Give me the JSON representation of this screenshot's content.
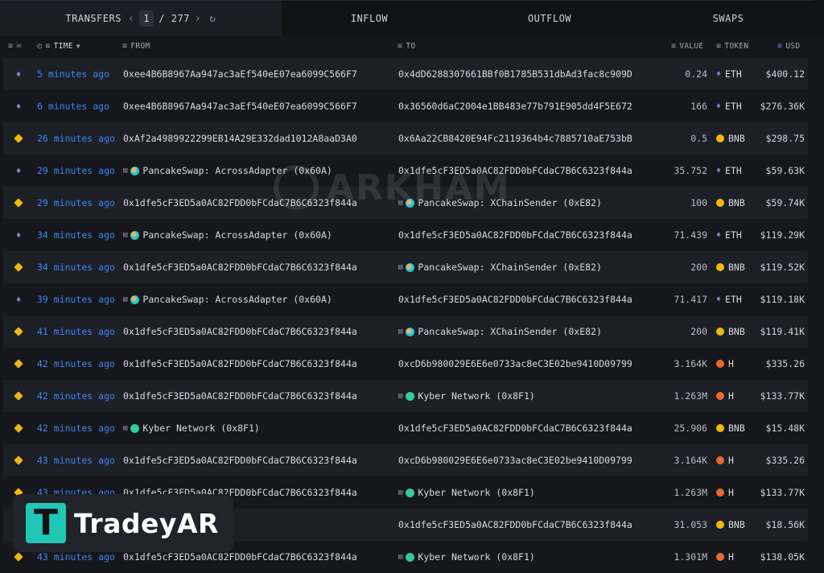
{
  "tabs": {
    "transfers": "TRANSFERS",
    "page_current": "1",
    "page_total": "/ 277",
    "inflow": "INFLOW",
    "outflow": "OUTFLOW",
    "swaps": "SWAPS"
  },
  "columns": {
    "time": "TIME",
    "from": "FROM",
    "to": "TO",
    "value": "VALUE",
    "token": "TOKEN",
    "usd": "USD"
  },
  "watermark": "ARKHAM",
  "brand": {
    "tile_letter": "T",
    "name": "TradeyAR"
  },
  "rows": [
    {
      "chain": "eth",
      "time": "5 minutes ago",
      "from": "0xee4B6B8967Aa947ac3aEf540eE07ea6099C566F7",
      "from_entity": "",
      "from_icon": "",
      "to": "0x4dD6288307661BBf0B1785B531dbAd3fac8c909D",
      "to_entity": "",
      "to_icon": "",
      "value": "0.24",
      "token": "ETH",
      "usd": "$400.12"
    },
    {
      "chain": "eth",
      "time": "6 minutes ago",
      "from": "0xee4B6B8967Aa947ac3aEf540eE07ea6099C566F7",
      "from_entity": "",
      "from_icon": "",
      "to": "0x36560d6aC2004e1BB483e77b791E905dd4F5E672",
      "to_entity": "",
      "to_icon": "",
      "value": "166",
      "token": "ETH",
      "usd": "$276.36K"
    },
    {
      "chain": "bnb",
      "time": "26 minutes ago",
      "from": "0xAf2a4989922299EB14A29E332dad1012A8aaD3A0",
      "from_entity": "",
      "from_icon": "",
      "to": "0x6Aa22CB8420E94Fc2119364b4c7885710aE753bB",
      "to_entity": "",
      "to_icon": "",
      "value": "0.5",
      "token": "BNB",
      "usd": "$298.75"
    },
    {
      "chain": "eth",
      "time": "29 minutes ago",
      "from": "",
      "from_entity": "PancakeSwap: AcrossAdapter (0x60A)",
      "from_icon": "cake",
      "to": "0x1dfe5cF3ED5a0AC82FDD0bFCdaC7B6C6323f844a",
      "to_entity": "",
      "to_icon": "",
      "value": "35.752",
      "token": "ETH",
      "usd": "$59.63K"
    },
    {
      "chain": "bnb",
      "time": "29 minutes ago",
      "from": "0x1dfe5cF3ED5a0AC82FDD0bFCdaC7B6C6323f844a",
      "from_entity": "",
      "from_icon": "",
      "to": "",
      "to_entity": "PancakeSwap: XChainSender (0xE82)",
      "to_icon": "cake",
      "value": "100",
      "token": "BNB",
      "usd": "$59.74K"
    },
    {
      "chain": "eth",
      "time": "34 minutes ago",
      "from": "",
      "from_entity": "PancakeSwap: AcrossAdapter (0x60A)",
      "from_icon": "cake",
      "to": "0x1dfe5cF3ED5a0AC82FDD0bFCdaC7B6C6323f844a",
      "to_entity": "",
      "to_icon": "",
      "value": "71.439",
      "token": "ETH",
      "usd": "$119.29K"
    },
    {
      "chain": "bnb",
      "time": "34 minutes ago",
      "from": "0x1dfe5cF3ED5a0AC82FDD0bFCdaC7B6C6323f844a",
      "from_entity": "",
      "from_icon": "",
      "to": "",
      "to_entity": "PancakeSwap: XChainSender (0xE82)",
      "to_icon": "cake",
      "value": "200",
      "token": "BNB",
      "usd": "$119.52K"
    },
    {
      "chain": "eth",
      "time": "39 minutes ago",
      "from": "",
      "from_entity": "PancakeSwap: AcrossAdapter (0x60A)",
      "from_icon": "cake",
      "to": "0x1dfe5cF3ED5a0AC82FDD0bFCdaC7B6C6323f844a",
      "to_entity": "",
      "to_icon": "",
      "value": "71.417",
      "token": "ETH",
      "usd": "$119.18K"
    },
    {
      "chain": "bnb",
      "time": "41 minutes ago",
      "from": "0x1dfe5cF3ED5a0AC82FDD0bFCdaC7B6C6323f844a",
      "from_entity": "",
      "from_icon": "",
      "to": "",
      "to_entity": "PancakeSwap: XChainSender (0xE82)",
      "to_icon": "cake",
      "value": "200",
      "token": "BNB",
      "usd": "$119.41K"
    },
    {
      "chain": "bnb",
      "time": "42 minutes ago",
      "from": "0x1dfe5cF3ED5a0AC82FDD0bFCdaC7B6C6323f844a",
      "from_entity": "",
      "from_icon": "",
      "to": "0xcD6b980029E6E6e0733ac8eC3E02be9410D09799",
      "to_entity": "",
      "to_icon": "",
      "value": "3.164K",
      "token": "H",
      "usd": "$335.26"
    },
    {
      "chain": "bnb",
      "time": "42 minutes ago",
      "from": "0x1dfe5cF3ED5a0AC82FDD0bFCdaC7B6C6323f844a",
      "from_entity": "",
      "from_icon": "",
      "to": "",
      "to_entity": "Kyber Network (0x8F1)",
      "to_icon": "kyber",
      "value": "1.263M",
      "token": "H",
      "usd": "$133.77K"
    },
    {
      "chain": "bnb",
      "time": "42 minutes ago",
      "from": "",
      "from_entity": "Kyber Network (0x8F1)",
      "from_icon": "kyber",
      "to": "0x1dfe5cF3ED5a0AC82FDD0bFCdaC7B6C6323f844a",
      "to_entity": "",
      "to_icon": "",
      "value": "25.906",
      "token": "BNB",
      "usd": "$15.48K"
    },
    {
      "chain": "bnb",
      "time": "43 minutes ago",
      "from": "0x1dfe5cF3ED5a0AC82FDD0bFCdaC7B6C6323f844a",
      "from_entity": "",
      "from_icon": "",
      "to": "0xcD6b980029E6E6e0733ac8eC3E02be9410D09799",
      "to_entity": "",
      "to_icon": "",
      "value": "3.164K",
      "token": "H",
      "usd": "$335.26"
    },
    {
      "chain": "bnb",
      "time": "43 minutes ago",
      "from": "0x1dfe5cF3ED5a0AC82FDD0bFCdaC7B6C6323f844a",
      "from_entity": "",
      "from_icon": "",
      "to": "",
      "to_entity": "Kyber Network (0x8F1)",
      "to_icon": "kyber",
      "value": "1.263M",
      "token": "H",
      "usd": "$133.77K"
    },
    {
      "chain": "bnb",
      "time": "",
      "from": "",
      "from_entity": "(0x8F1)",
      "from_icon": "",
      "to": "0x1dfe5cF3ED5a0AC82FDD0bFCdaC7B6C6323f844a",
      "to_entity": "",
      "to_icon": "",
      "value": "31.053",
      "token": "BNB",
      "usd": "$18.56K"
    },
    {
      "chain": "bnb",
      "time": "43 minutes ago",
      "from": "0x1dfe5cF3ED5a0AC82FDD0bFCdaC7B6C6323f844a",
      "from_entity": "",
      "from_icon": "",
      "to": "",
      "to_entity": "Kyber Network (0x8F1)",
      "to_icon": "kyber",
      "value": "1.301M",
      "token": "H",
      "usd": "$138.05K"
    }
  ]
}
